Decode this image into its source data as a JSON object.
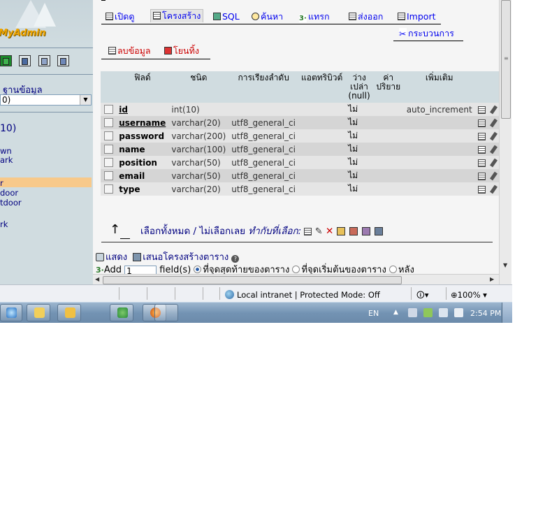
{
  "sidebar": {
    "logo": "MyAdmin",
    "database_label": "ฐานข้อมูล",
    "database_select": "0)",
    "table_count": "10)",
    "tables": [
      "wn",
      "ark",
      "r",
      "door",
      "tdoor",
      "rk"
    ],
    "highlighted_table": "r"
  },
  "tabs": {
    "browse": "เปิดดู",
    "structure": "โครงสร้าง",
    "sql": "SQL",
    "search": "ค้นหา",
    "insert": "แทรก",
    "export": "ส่งออก",
    "import": "Import",
    "operations": "กระบวนการ",
    "empty": "ลบข้อมูล",
    "drop": "โยนทิ้ง"
  },
  "table": {
    "headers": [
      "ฟิลด์",
      "ชนิด",
      "การเรียงลำดับ",
      "แอตทริบิวต์",
      "ว่างเปล่า (null)",
      "ค่าปริยาย",
      "เพิ่มเติม"
    ],
    "rows": [
      {
        "field": "id",
        "type": "int(10)",
        "collation": "",
        "attributes": "",
        "null": "ไม่",
        "default": "",
        "extra": "auto_increment",
        "pk": true
      },
      {
        "field": "username",
        "type": "varchar(20)",
        "collation": "utf8_general_ci",
        "attributes": "",
        "null": "ไม่",
        "default": "",
        "extra": "",
        "pk": true
      },
      {
        "field": "password",
        "type": "varchar(200)",
        "collation": "utf8_general_ci",
        "attributes": "",
        "null": "ไม่",
        "default": "",
        "extra": "",
        "pk": false
      },
      {
        "field": "name",
        "type": "varchar(100)",
        "collation": "utf8_general_ci",
        "attributes": "",
        "null": "ไม่",
        "default": "",
        "extra": "",
        "pk": false
      },
      {
        "field": "position",
        "type": "varchar(50)",
        "collation": "utf8_general_ci",
        "attributes": "",
        "null": "ไม่",
        "default": "",
        "extra": "",
        "pk": false
      },
      {
        "field": "email",
        "type": "varchar(50)",
        "collation": "utf8_general_ci",
        "attributes": "",
        "null": "ไม่",
        "default": "",
        "extra": "",
        "pk": false
      },
      {
        "field": "type",
        "type": "varchar(20)",
        "collation": "utf8_general_ci",
        "attributes": "",
        "null": "ไม่",
        "default": "",
        "extra": "",
        "pk": false
      }
    ]
  },
  "bulk": {
    "select_all": "เลือกทั้งหมด",
    "separator": " / ",
    "select_none": "ไม่เลือกเลย",
    "with_selected": "ทำกับที่เลือก:"
  },
  "footer": {
    "print": "แสดง",
    "propose": "เสนอโครงสร้างตาราง",
    "add_label": "Add",
    "add_value": "1",
    "fields_label": "field(s)",
    "opt_end": "ที่จุดสุดท้ายของตาราง",
    "opt_begin": "ที่จุดเริ่มต้นของตาราง",
    "opt_after": "หลัง"
  },
  "statusbar": {
    "zone": "Local intranet | Protected Mode: Off",
    "zoom": "100%"
  },
  "taskbar": {
    "lang": "EN",
    "clock": "2:54 PM"
  }
}
